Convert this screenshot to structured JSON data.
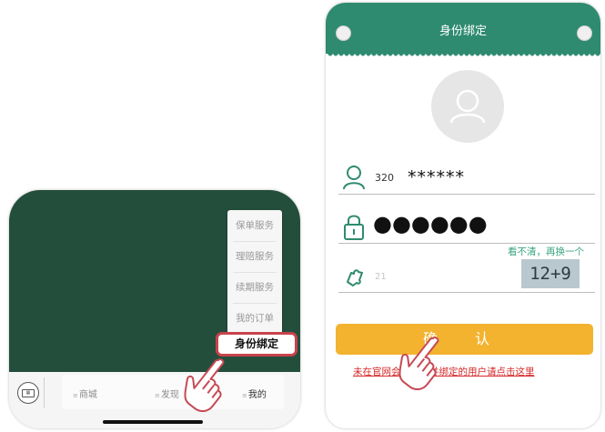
{
  "left_phone": {
    "menu_items": [
      "保单服务",
      "理赔服务",
      "续期服务",
      "我的订单"
    ],
    "highlighted_item": "身份绑定",
    "tabs": [
      "商城",
      "发现",
      "我的"
    ],
    "keyboard_icon": "keyboard-icon"
  },
  "right_phone": {
    "title": "身份绑定",
    "account_prefix": "320",
    "account_masked": "******",
    "password_masked": "●●●●●●",
    "captcha_refresh": "看不清，再换一个",
    "captcha_placeholder": "21",
    "captcha_image_text": "12+9",
    "confirm_label": "确 认",
    "register_link": "未在官网会员注册并绑定的用户请点击这里"
  },
  "colors": {
    "left_green": "#244e3c",
    "header_green": "#2f8b70",
    "confirm_yellow": "#f3b32f",
    "link_red": "#d72a2a",
    "highlight_border": "#c8424c"
  }
}
